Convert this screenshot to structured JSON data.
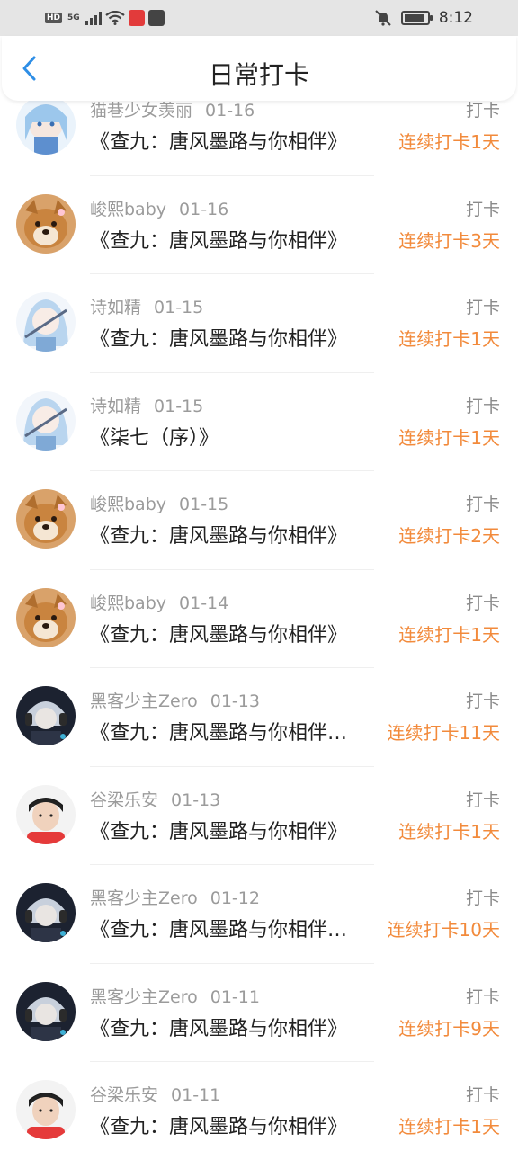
{
  "status_bar": {
    "hd_label": "HD",
    "network_label": "5G",
    "time": "8:12",
    "icons": [
      "signal-icon",
      "wifi-icon",
      "app-notification-icon",
      "calendar-icon",
      "bell-muted-icon",
      "battery-icon"
    ],
    "battery_level": 0.9
  },
  "header": {
    "title": "日常打卡",
    "back_icon": "chevron-left-icon",
    "accent_color": "#2e8ee6"
  },
  "colors": {
    "streak": "#f28a3b",
    "meta": "#9b9b9b"
  },
  "entries": [
    {
      "user": "猫巷少女羡丽",
      "date": "01-16",
      "action": "打卡",
      "book": "《查九：唐风墨路与你相伴》",
      "streak": "连续打卡1天",
      "avatar": "anime-girl-blue"
    },
    {
      "user": "峻熙baby",
      "date": "01-16",
      "action": "打卡",
      "book": "《查九：唐风墨路与你相伴》",
      "streak": "连续打卡3天",
      "avatar": "shiba-dog"
    },
    {
      "user": "诗如精",
      "date": "01-15",
      "action": "打卡",
      "book": "《查九：唐风墨路与你相伴》",
      "streak": "连续打卡1天",
      "avatar": "anime-girl-light"
    },
    {
      "user": "诗如精",
      "date": "01-15",
      "action": "打卡",
      "book": "《柒七（序）》",
      "streak": "连续打卡1天",
      "avatar": "anime-girl-light"
    },
    {
      "user": "峻熙baby",
      "date": "01-15",
      "action": "打卡",
      "book": "《查九：唐风墨路与你相伴》",
      "streak": "连续打卡2天",
      "avatar": "shiba-dog"
    },
    {
      "user": "峻熙baby",
      "date": "01-14",
      "action": "打卡",
      "book": "《查九：唐风墨路与你相伴》",
      "streak": "连续打卡1天",
      "avatar": "shiba-dog"
    },
    {
      "user": "黑客少主Zero",
      "date": "01-13",
      "action": "打卡",
      "book": "《查九：唐风墨路与你相伴…",
      "streak": "连续打卡11天",
      "avatar": "anime-boy-dark"
    },
    {
      "user": "谷梁乐安",
      "date": "01-13",
      "action": "打卡",
      "book": "《查九：唐风墨路与你相伴》",
      "streak": "连续打卡1天",
      "avatar": "boy-photo"
    },
    {
      "user": "黑客少主Zero",
      "date": "01-12",
      "action": "打卡",
      "book": "《查九：唐风墨路与你相伴…",
      "streak": "连续打卡10天",
      "avatar": "anime-boy-dark"
    },
    {
      "user": "黑客少主Zero",
      "date": "01-11",
      "action": "打卡",
      "book": "《查九：唐风墨路与你相伴》",
      "streak": "连续打卡9天",
      "avatar": "anime-boy-dark"
    },
    {
      "user": "谷梁乐安",
      "date": "01-11",
      "action": "打卡",
      "book": "《查九：唐风墨路与你相伴》",
      "streak": "连续打卡1天",
      "avatar": "boy-photo"
    }
  ]
}
